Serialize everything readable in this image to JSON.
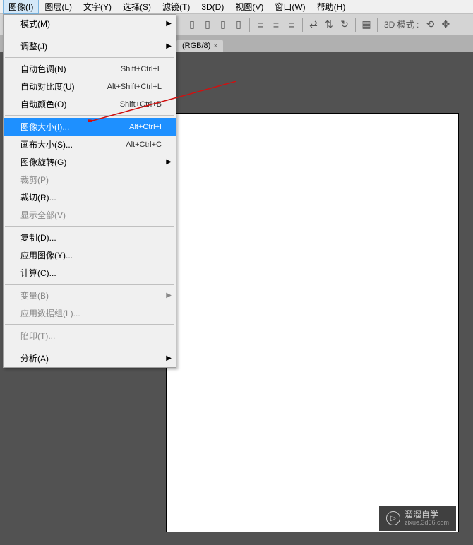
{
  "menubar": {
    "items": [
      "图像(I)",
      "图层(L)",
      "文字(Y)",
      "选择(S)",
      "滤镜(T)",
      "3D(D)",
      "视图(V)",
      "窗口(W)",
      "帮助(H)"
    ]
  },
  "toolbar": {
    "mode3d_label": "3D 模式 :"
  },
  "tab": {
    "label": "(RGB/8)",
    "close": "×"
  },
  "dropdown": {
    "items": [
      {
        "label": "模式(M)",
        "submenu": true
      },
      {
        "sep": true
      },
      {
        "label": "调整(J)",
        "submenu": true
      },
      {
        "sep": true
      },
      {
        "label": "自动色调(N)",
        "shortcut": "Shift+Ctrl+L"
      },
      {
        "label": "自动对比度(U)",
        "shortcut": "Alt+Shift+Ctrl+L"
      },
      {
        "label": "自动颜色(O)",
        "shortcut": "Shift+Ctrl+B"
      },
      {
        "sep": true
      },
      {
        "label": "图像大小(I)...",
        "shortcut": "Alt+Ctrl+I",
        "highlighted": true
      },
      {
        "label": "画布大小(S)...",
        "shortcut": "Alt+Ctrl+C"
      },
      {
        "label": "图像旋转(G)",
        "submenu": true
      },
      {
        "label": "裁剪(P)",
        "disabled": true
      },
      {
        "label": "裁切(R)..."
      },
      {
        "label": "显示全部(V)",
        "disabled": true
      },
      {
        "sep": true
      },
      {
        "label": "复制(D)..."
      },
      {
        "label": "应用图像(Y)..."
      },
      {
        "label": "计算(C)..."
      },
      {
        "sep": true
      },
      {
        "label": "变量(B)",
        "submenu": true,
        "disabled": true
      },
      {
        "label": "应用数据组(L)...",
        "disabled": true
      },
      {
        "sep": true
      },
      {
        "label": "陷印(T)...",
        "disabled": true
      },
      {
        "sep": true
      },
      {
        "label": "分析(A)",
        "submenu": true
      }
    ]
  },
  "watermark": {
    "title": "溜溜自学",
    "url": "zixue.3d66.com"
  }
}
